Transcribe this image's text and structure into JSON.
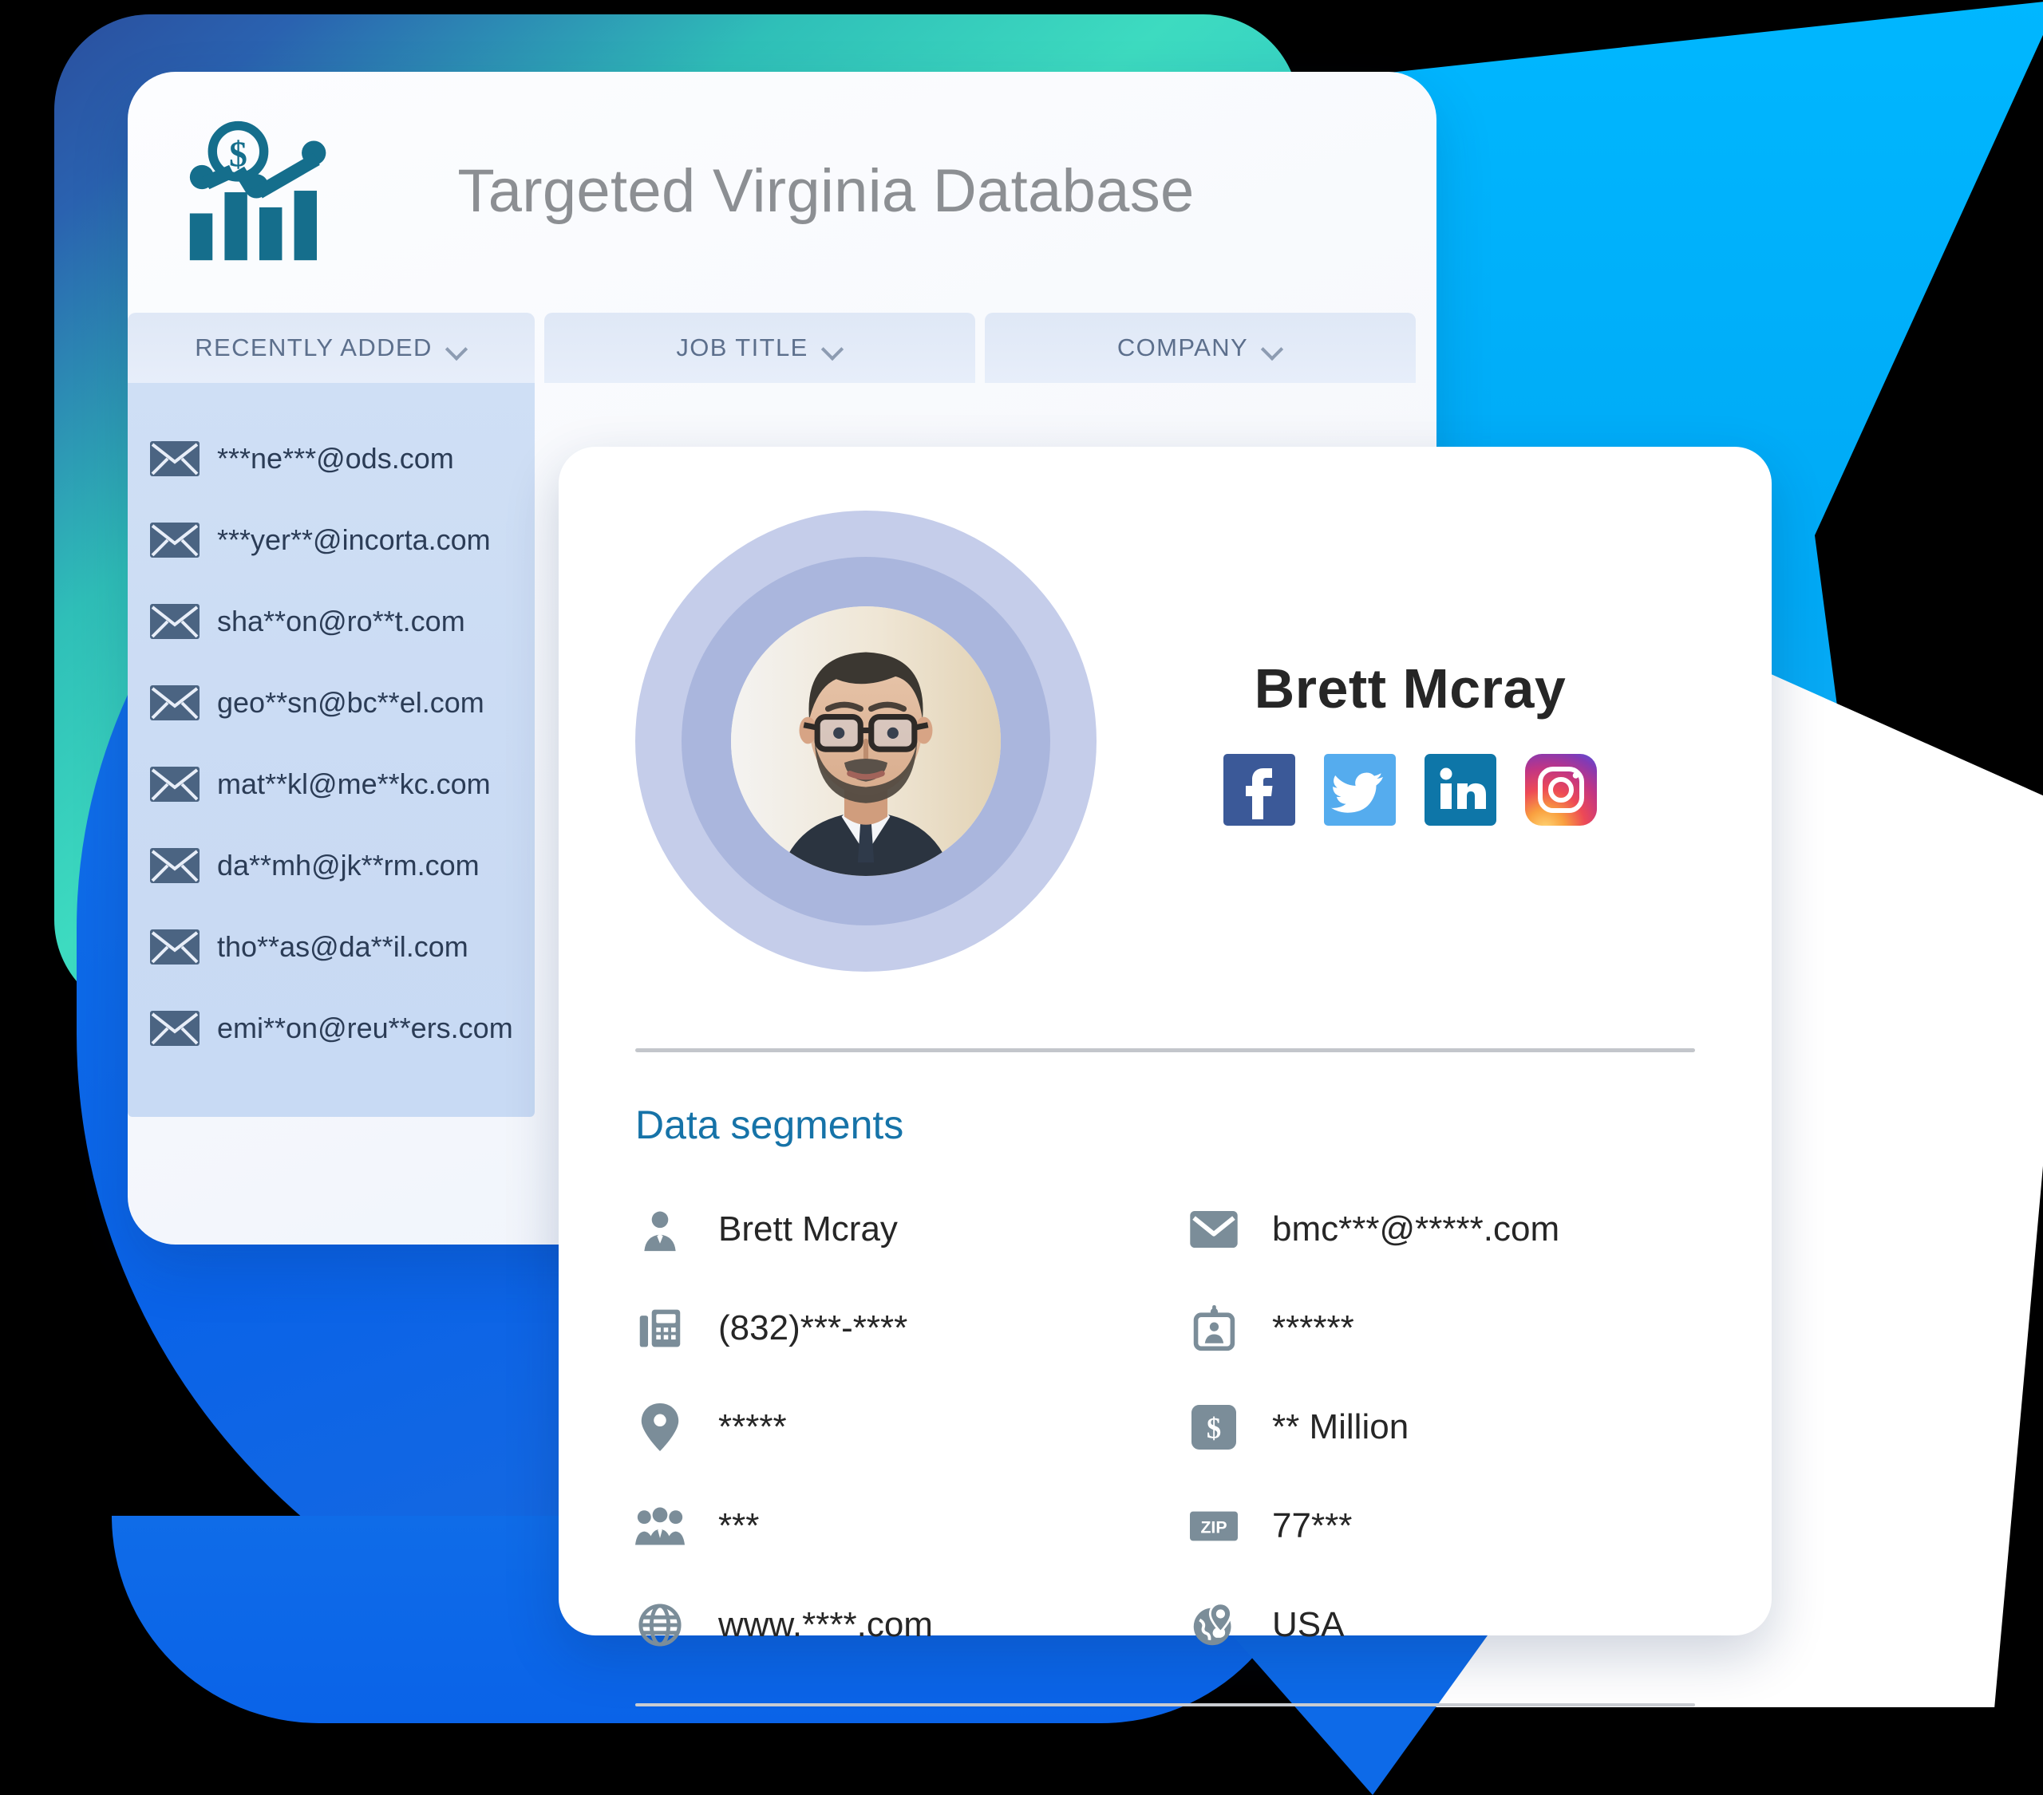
{
  "window": {
    "title": "Targeted Virginia Database",
    "logo_icon": "bar-chart-dollar-icon",
    "columns": [
      {
        "label": "RECENTLY ADDED",
        "chevron": "chevron-down-icon"
      },
      {
        "label": "JOB TITLE",
        "chevron": "chevron-down-icon"
      },
      {
        "label": "COMPANY",
        "chevron": "chevron-down-icon"
      }
    ],
    "emails": [
      {
        "icon": "envelope-icon",
        "text": "***ne***@ods.com"
      },
      {
        "icon": "envelope-icon",
        "text": "***yer**@incorta.com"
      },
      {
        "icon": "envelope-icon",
        "text": "sha**on@ro**t.com"
      },
      {
        "icon": "envelope-icon",
        "text": "geo**sn@bc**el.com"
      },
      {
        "icon": "envelope-icon",
        "text": "mat**kl@me**kc.com"
      },
      {
        "icon": "envelope-icon",
        "text": "da**mh@jk**rm.com"
      },
      {
        "icon": "envelope-icon",
        "text": "tho**as@da**il.com"
      },
      {
        "icon": "envelope-icon",
        "text": "emi**on@reu**ers.com"
      }
    ]
  },
  "profile": {
    "avatar_alt": "profile-photo-bearded-man-with-glasses",
    "name": "Brett Mcray",
    "socials": [
      {
        "name": "facebook-icon",
        "color": "#3b5998"
      },
      {
        "name": "twitter-icon",
        "color": "#55acee"
      },
      {
        "name": "linkedin-icon",
        "color": "#0e76a8"
      },
      {
        "name": "instagram-icon",
        "color": "#e1306c"
      }
    ],
    "segments_heading": "Data segments",
    "segments": [
      {
        "icon": "person-icon",
        "value": "Brett Mcray"
      },
      {
        "icon": "email-icon",
        "value": "bmc***@*****.com"
      },
      {
        "icon": "fax-icon",
        "value": "(832)***-****"
      },
      {
        "icon": "id-badge-icon",
        "value": "******"
      },
      {
        "icon": "location-pin-icon",
        "value": "*****"
      },
      {
        "icon": "dollar-icon",
        "value": "** Million"
      },
      {
        "icon": "people-group-icon",
        "value": "***"
      },
      {
        "icon": "zip-icon",
        "value": "77***"
      },
      {
        "icon": "globe-icon",
        "value": "www.****.com"
      },
      {
        "icon": "globe-pin-icon",
        "value": "USA"
      }
    ]
  },
  "theme": {
    "accent_blue": "#1673a8",
    "teal": "#3ddbc0",
    "primary_blue": "#0a63e8",
    "cyan": "#00b7ff",
    "logo_teal": "#156e8c",
    "icon_gray": "#7b8d99"
  }
}
